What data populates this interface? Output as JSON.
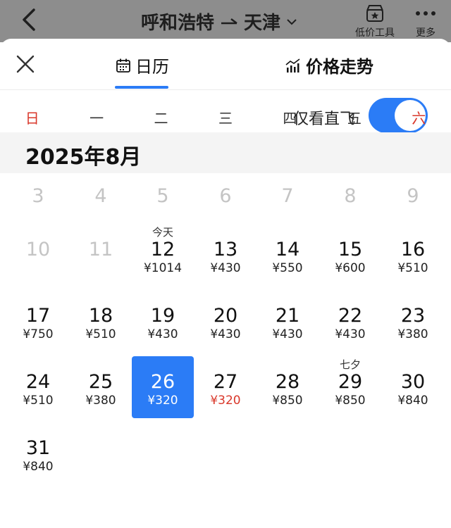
{
  "header": {
    "origin": "呼和浩特",
    "destination": "天津",
    "low_price_tool_label": "低价工具",
    "more_label": "更多"
  },
  "tabs": [
    {
      "label": "日历",
      "icon": "calendar-icon",
      "active": true
    },
    {
      "label": "价格走势",
      "icon": "trend-chart-icon",
      "active": false
    }
  ],
  "filter": {
    "direct_only_label": "仅看直飞",
    "direct_only_on": true
  },
  "weekdays": [
    "日",
    "一",
    "二",
    "三",
    "四",
    "五",
    "六"
  ],
  "month_title": "2025年8月",
  "colors": {
    "accent": "#2b7cf6",
    "low_price": "#d9372a",
    "weekend": "#d9372a"
  },
  "weeks": [
    [
      {
        "day": "3",
        "price": "",
        "note": "",
        "past": true
      },
      {
        "day": "4",
        "price": "",
        "note": "",
        "past": true
      },
      {
        "day": "5",
        "price": "",
        "note": "",
        "past": true
      },
      {
        "day": "6",
        "price": "",
        "note": "",
        "past": true
      },
      {
        "day": "7",
        "price": "",
        "note": "",
        "past": true
      },
      {
        "day": "8",
        "price": "",
        "note": "",
        "past": true
      },
      {
        "day": "9",
        "price": "",
        "note": "",
        "past": true
      }
    ],
    [
      {
        "day": "10",
        "price": "",
        "note": "",
        "past": true
      },
      {
        "day": "11",
        "price": "",
        "note": "",
        "past": true
      },
      {
        "day": "12",
        "price": "¥1014",
        "note": "今天"
      },
      {
        "day": "13",
        "price": "¥430",
        "note": ""
      },
      {
        "day": "14",
        "price": "¥550",
        "note": ""
      },
      {
        "day": "15",
        "price": "¥600",
        "note": ""
      },
      {
        "day": "16",
        "price": "¥510",
        "note": ""
      }
    ],
    [
      {
        "day": "17",
        "price": "¥750",
        "note": ""
      },
      {
        "day": "18",
        "price": "¥510",
        "note": ""
      },
      {
        "day": "19",
        "price": "¥430",
        "note": ""
      },
      {
        "day": "20",
        "price": "¥430",
        "note": ""
      },
      {
        "day": "21",
        "price": "¥430",
        "note": ""
      },
      {
        "day": "22",
        "price": "¥430",
        "note": ""
      },
      {
        "day": "23",
        "price": "¥380",
        "note": ""
      }
    ],
    [
      {
        "day": "24",
        "price": "¥510",
        "note": ""
      },
      {
        "day": "25",
        "price": "¥380",
        "note": ""
      },
      {
        "day": "26",
        "price": "¥320",
        "note": "",
        "selected": true
      },
      {
        "day": "27",
        "price": "¥320",
        "note": "",
        "low": true
      },
      {
        "day": "28",
        "price": "¥850",
        "note": ""
      },
      {
        "day": "29",
        "price": "¥850",
        "note": "七夕"
      },
      {
        "day": "30",
        "price": "¥840",
        "note": ""
      }
    ],
    [
      {
        "day": "31",
        "price": "¥840",
        "note": ""
      }
    ]
  ]
}
